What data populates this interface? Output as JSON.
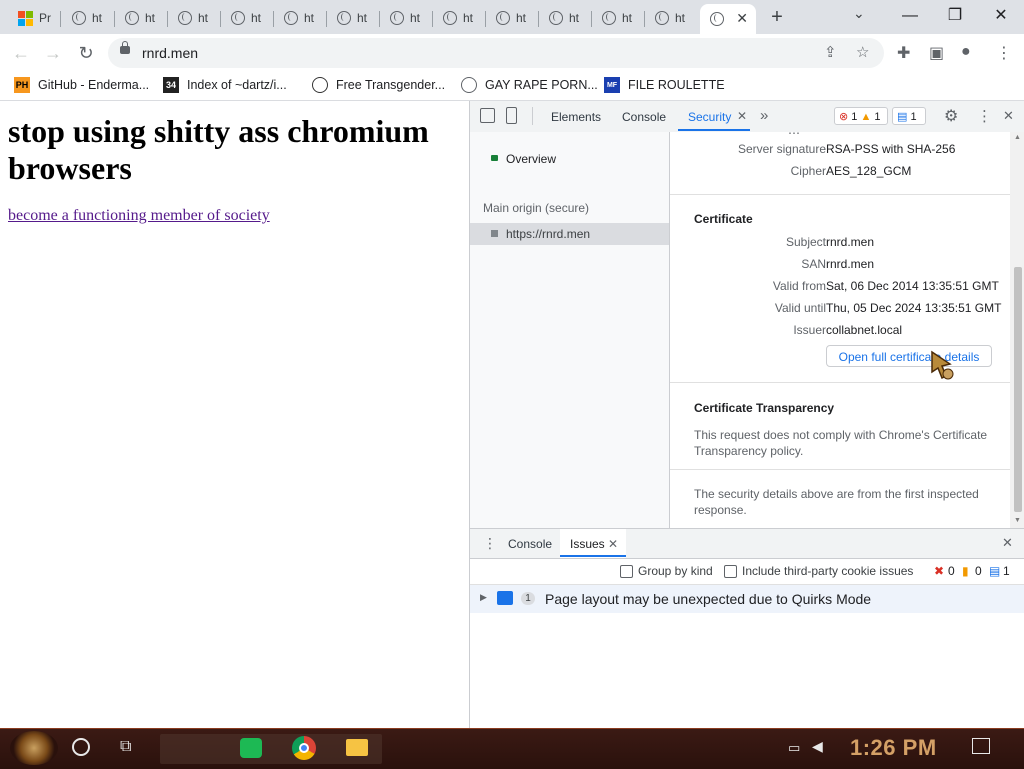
{
  "browser": {
    "tabs": [
      {
        "title": "Pr",
        "active": false
      },
      {
        "title": "ht",
        "active": false
      },
      {
        "title": "ht",
        "active": false
      },
      {
        "title": "ht",
        "active": false
      },
      {
        "title": "ht",
        "active": false
      },
      {
        "title": "ht",
        "active": false
      },
      {
        "title": "ht",
        "active": false
      },
      {
        "title": "ht",
        "active": false
      },
      {
        "title": "ht",
        "active": false
      },
      {
        "title": "ht",
        "active": false
      },
      {
        "title": "ht",
        "active": false
      },
      {
        "title": "ht",
        "active": false
      },
      {
        "title": "ht",
        "active": false
      },
      {
        "title": "",
        "active": true
      }
    ],
    "window_controls": {
      "minimize": "—",
      "restore": "❐",
      "close": "✕"
    },
    "url": "rnrd.men",
    "bookmarks": [
      {
        "label": "GitHub - Enderma...",
        "icon": "ph-icon",
        "icon_text": "PH"
      },
      {
        "label": "Index of ~dartz/i...",
        "icon": "index-icon",
        "icon_text": "34"
      },
      {
        "label": "Free Transgender...",
        "icon": "mask-icon",
        "icon_text": ""
      },
      {
        "label": "GAY RAPE PORN...",
        "icon": "globe-icon",
        "icon_text": ""
      },
      {
        "label": "FILE ROULETTE",
        "icon": "roulette-icon",
        "icon_text": "MF"
      }
    ]
  },
  "page": {
    "heading": "stop using shitty ass chromium browsers",
    "link": "become a functioning member of society"
  },
  "devtools": {
    "tabs": [
      "Elements",
      "Console",
      "Security"
    ],
    "active_tab": "Security",
    "badges": {
      "errors": "1",
      "warnings": "1",
      "messages": "1"
    },
    "sidebar": {
      "overview": "Overview",
      "main_origin_header": "Main origin (secure)",
      "origin": "https://rnrd.men"
    },
    "connection": {
      "server_signature_label": "Server signature",
      "server_signature": "RSA-PSS with SHA-256",
      "cipher_label": "Cipher",
      "cipher": "AES_128_GCM"
    },
    "certificate": {
      "title": "Certificate",
      "subject_label": "Subject",
      "subject": "rnrd.men",
      "san_label": "SAN",
      "san": "rnrd.men",
      "valid_from_label": "Valid from",
      "valid_from": "Sat, 06 Dec 2014 13:35:51 GMT",
      "valid_until_label": "Valid until",
      "valid_until": "Thu, 05 Dec 2024 13:35:51 GMT",
      "issuer_label": "Issuer",
      "issuer": "collabnet.local",
      "details_button": "Open full certificate details"
    },
    "transparency": {
      "title": "Certificate Transparency",
      "text": "This request does not comply with Chrome's Certificate Transparency policy."
    },
    "footer_note": "The security details above are from the first inspected response.",
    "drawer": {
      "tabs": [
        "Console",
        "Issues"
      ],
      "active_tab": "Issues",
      "group_by_kind": "Group by kind",
      "include_third_party": "Include third-party cookie issues",
      "counts": {
        "errors": "0",
        "warnings": "0",
        "messages": "1"
      },
      "issue_count": "1",
      "issue_text": "Page layout may be unexpected due to Quirks Mode"
    }
  },
  "taskbar": {
    "clock": "1:26 PM"
  },
  "colors": {
    "accent": "#1a73e8",
    "visited_link": "#551a8b",
    "taskbar_bg": "#2a110c",
    "clock": "#d4a066"
  }
}
